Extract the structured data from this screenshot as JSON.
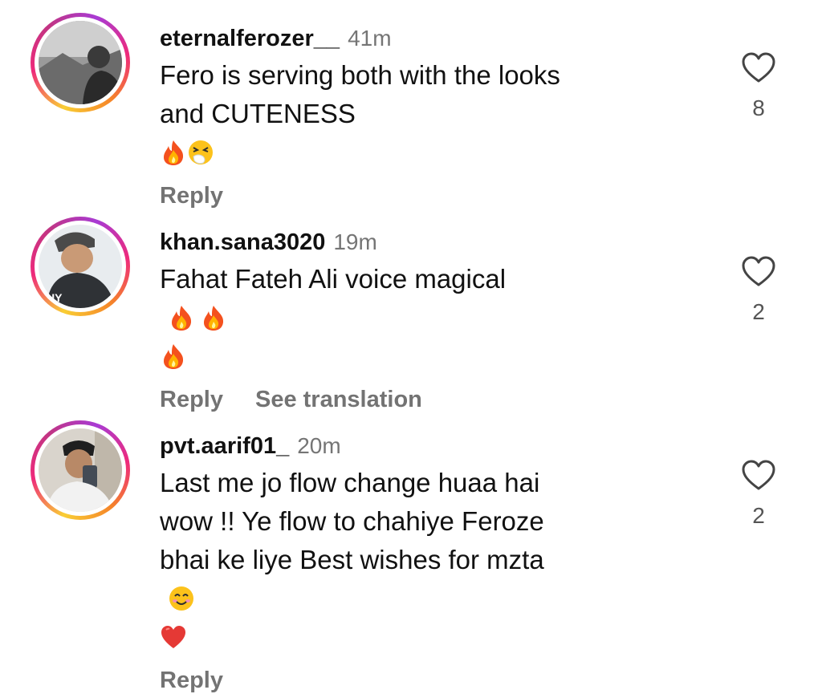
{
  "comments": [
    {
      "username": "eternalferozer__",
      "time": "41m",
      "text": "Fero is serving both with the looks\nand CUTENESS",
      "emojis": [
        "fire-emoji",
        "sneezing-face-emoji"
      ],
      "reply_label": "Reply",
      "likes": "8"
    },
    {
      "username": "khan.sana3020",
      "time": "19m",
      "text": "Fahat Fateh Ali voice magical",
      "emojis": [
        "fire-emoji",
        "fire-emoji",
        "fire-emoji"
      ],
      "reply_label": "Reply",
      "translate_label": "See translation",
      "likes": "2"
    },
    {
      "username": "pvt.aarif01_",
      "time": "20m",
      "text": "Last me jo flow change huaa hai\nwow !! Ye flow to chahiye Feroze\nbhai ke liye Best wishes for mzta",
      "emojis": [
        "smiling-face-emoji",
        "red-heart-emoji"
      ],
      "reply_label": "Reply",
      "likes": "2"
    }
  ],
  "colors": {
    "username": "#111111",
    "timestamp": "#757575",
    "action": "#737373",
    "story_ring": [
      "#f9ce34",
      "#ee2a7b",
      "#c13584"
    ]
  }
}
